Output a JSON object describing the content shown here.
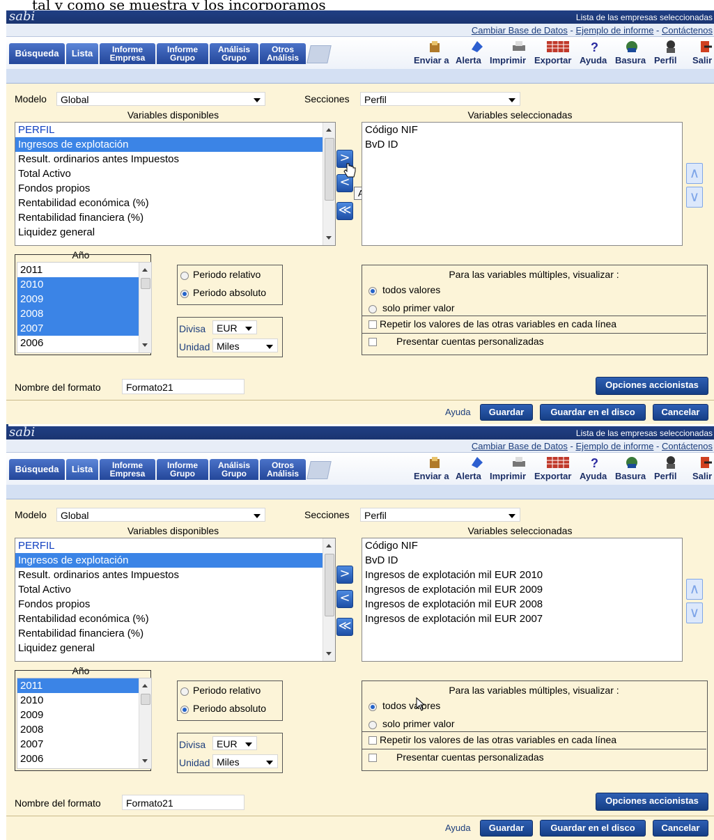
{
  "caption": "tal y como se muestra y los incorporamos",
  "header": {
    "brand": "sabi",
    "list_link": "Lista de las empresas seleccionadas",
    "links": [
      "Cambiar Base de Datos",
      "Ejemplo de informe",
      "Contáctenos"
    ],
    "separator": " - "
  },
  "nav": {
    "tabs": [
      {
        "l1": "Búsqueda",
        "l2": ""
      },
      {
        "l1": "Lista",
        "l2": ""
      },
      {
        "l1": "Informe",
        "l2": "Empresa"
      },
      {
        "l1": "Informe",
        "l2": "Grupo"
      },
      {
        "l1": "Análisis",
        "l2": "Grupo"
      },
      {
        "l1": "Otros",
        "l2": "Análisis"
      }
    ],
    "toolbar": [
      "Enviar a",
      "Alerta",
      "Imprimir",
      "Exportar",
      "Ayuda",
      "Basura",
      "Perfil",
      "Salir"
    ]
  },
  "form": {
    "modelo_label": "Modelo",
    "modelo_value": "Global",
    "secciones_label": "Secciones",
    "secciones_value": "Perfil",
    "disponibles_header": "Variables disponibles",
    "seleccionadas_header": "Variables seleccionadas",
    "disponibles": [
      "PERFIL",
      "Ingresos de explotación",
      "Result. ordinarios antes Impuestos",
      "Total Activo",
      "Fondos propios",
      "Rentabilidad económica (%)",
      "Rentabilidad financiera (%)",
      "Liquidez general"
    ],
    "ano_label": "Año",
    "anos": [
      "2011",
      "2010",
      "2009",
      "2008",
      "2007",
      "2006"
    ],
    "periodo_relativo": "Periodo relativo",
    "periodo_absoluto": "Periodo absoluto",
    "divisa_label": "Divisa",
    "divisa_value": "EUR",
    "unidad_label": "Unidad",
    "unidad_value": "Miles",
    "multiples_title": "Para las variables múltiples, visualizar :",
    "todos": "todos valores",
    "solo": "solo primer valor",
    "repetir": "Repetir los valores de las otras variables en cada línea",
    "presentar": "Presentar cuentas personalizadas",
    "nombre_label": "Nombre del formato",
    "nombre_value": "Formato21",
    "opciones": "Opciones accionistas"
  },
  "buttons": {
    "ayuda": "Ayuda",
    "guardar": "Guardar",
    "guardar_disco": "Guardar en el disco",
    "cancelar": "Cancelar"
  },
  "tooltip": "Add",
  "panels": [
    {
      "selected_vars": [
        "Código NIF",
        "BvD ID"
      ]
    },
    {
      "selected_vars": [
        "Código NIF",
        "BvD ID",
        "Ingresos de explotación mil EUR 2010",
        "Ingresos de explotación mil EUR 2009",
        "Ingresos de explotación mil EUR 2008",
        "Ingresos de explotación mil EUR 2007"
      ]
    }
  ],
  "colors": {
    "header": "#203f84",
    "form_bg": "#fcf4d8",
    "selection": "#3b84e6",
    "button": "#1e4fa6"
  }
}
